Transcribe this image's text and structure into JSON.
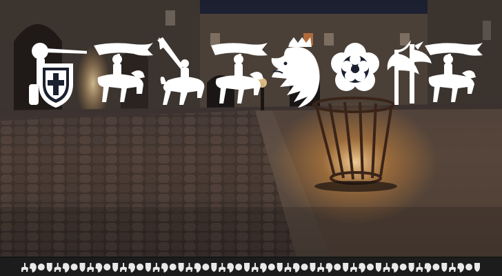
{
  "preview": {
    "glyphs": [
      {
        "icon": "crusader-shield-icon"
      },
      {
        "icon": "banner-knight-icon"
      },
      {
        "icon": "charging-knight-icon"
      },
      {
        "icon": "banner-knight-icon"
      },
      {
        "icon": "lion-head-icon"
      },
      {
        "icon": "tudor-rose-icon"
      },
      {
        "icon": "battle-axe-icon"
      },
      {
        "icon": "banner-knight-icon"
      }
    ],
    "strip_glyph_count": 56
  },
  "colors": {
    "glyph_fill": "#ffffff",
    "strip_background": "#1c1c1c",
    "strip_glyph": "#e9e9e9",
    "ground": "#4a3a30",
    "sky": "#1b2030"
  }
}
